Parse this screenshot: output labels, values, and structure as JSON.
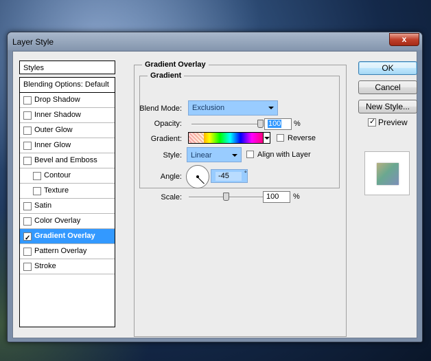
{
  "window": {
    "title": "Layer Style",
    "close_glyph": "x"
  },
  "styles_header": "Styles",
  "style_list": [
    {
      "label": "Blending Options: Default",
      "has_checkbox": false,
      "checked": false,
      "indent": false,
      "selected": false
    },
    {
      "label": "Drop Shadow",
      "has_checkbox": true,
      "checked": false,
      "indent": false,
      "selected": false
    },
    {
      "label": "Inner Shadow",
      "has_checkbox": true,
      "checked": false,
      "indent": false,
      "selected": false
    },
    {
      "label": "Outer Glow",
      "has_checkbox": true,
      "checked": false,
      "indent": false,
      "selected": false
    },
    {
      "label": "Inner Glow",
      "has_checkbox": true,
      "checked": false,
      "indent": false,
      "selected": false
    },
    {
      "label": "Bevel and Emboss",
      "has_checkbox": true,
      "checked": false,
      "indent": false,
      "selected": false
    },
    {
      "label": "Contour",
      "has_checkbox": true,
      "checked": false,
      "indent": true,
      "selected": false
    },
    {
      "label": "Texture",
      "has_checkbox": true,
      "checked": false,
      "indent": true,
      "selected": false
    },
    {
      "label": "Satin",
      "has_checkbox": true,
      "checked": false,
      "indent": false,
      "selected": false
    },
    {
      "label": "Color Overlay",
      "has_checkbox": true,
      "checked": false,
      "indent": false,
      "selected": false
    },
    {
      "label": "Gradient Overlay",
      "has_checkbox": true,
      "checked": true,
      "indent": false,
      "selected": true
    },
    {
      "label": "Pattern Overlay",
      "has_checkbox": true,
      "checked": false,
      "indent": false,
      "selected": false
    },
    {
      "label": "Stroke",
      "has_checkbox": true,
      "checked": false,
      "indent": false,
      "selected": false
    }
  ],
  "panel": {
    "title": "Gradient Overlay",
    "group_title": "Gradient",
    "blend_mode": {
      "label": "Blend Mode:",
      "value": "Exclusion"
    },
    "opacity": {
      "label": "Opacity:",
      "value": "100",
      "unit": "%",
      "fraction": 1.0
    },
    "gradient": {
      "label": "Gradient:",
      "reverse_label": "Reverse",
      "reverse_checked": false
    },
    "style": {
      "label": "Style:",
      "value": "Linear",
      "align_label": "Align with Layer",
      "align_checked": false
    },
    "angle": {
      "label": "Angle:",
      "value": "-45",
      "unit": "°"
    },
    "scale": {
      "label": "Scale:",
      "value": "100",
      "unit": "%",
      "fraction": 0.5
    }
  },
  "buttons": {
    "ok": "OK",
    "cancel": "Cancel",
    "new_style": "New Style..."
  },
  "preview": {
    "label": "Preview",
    "checked": true
  },
  "colors": {
    "selection": "#3399ff",
    "field_highlight": "#99ccff"
  }
}
